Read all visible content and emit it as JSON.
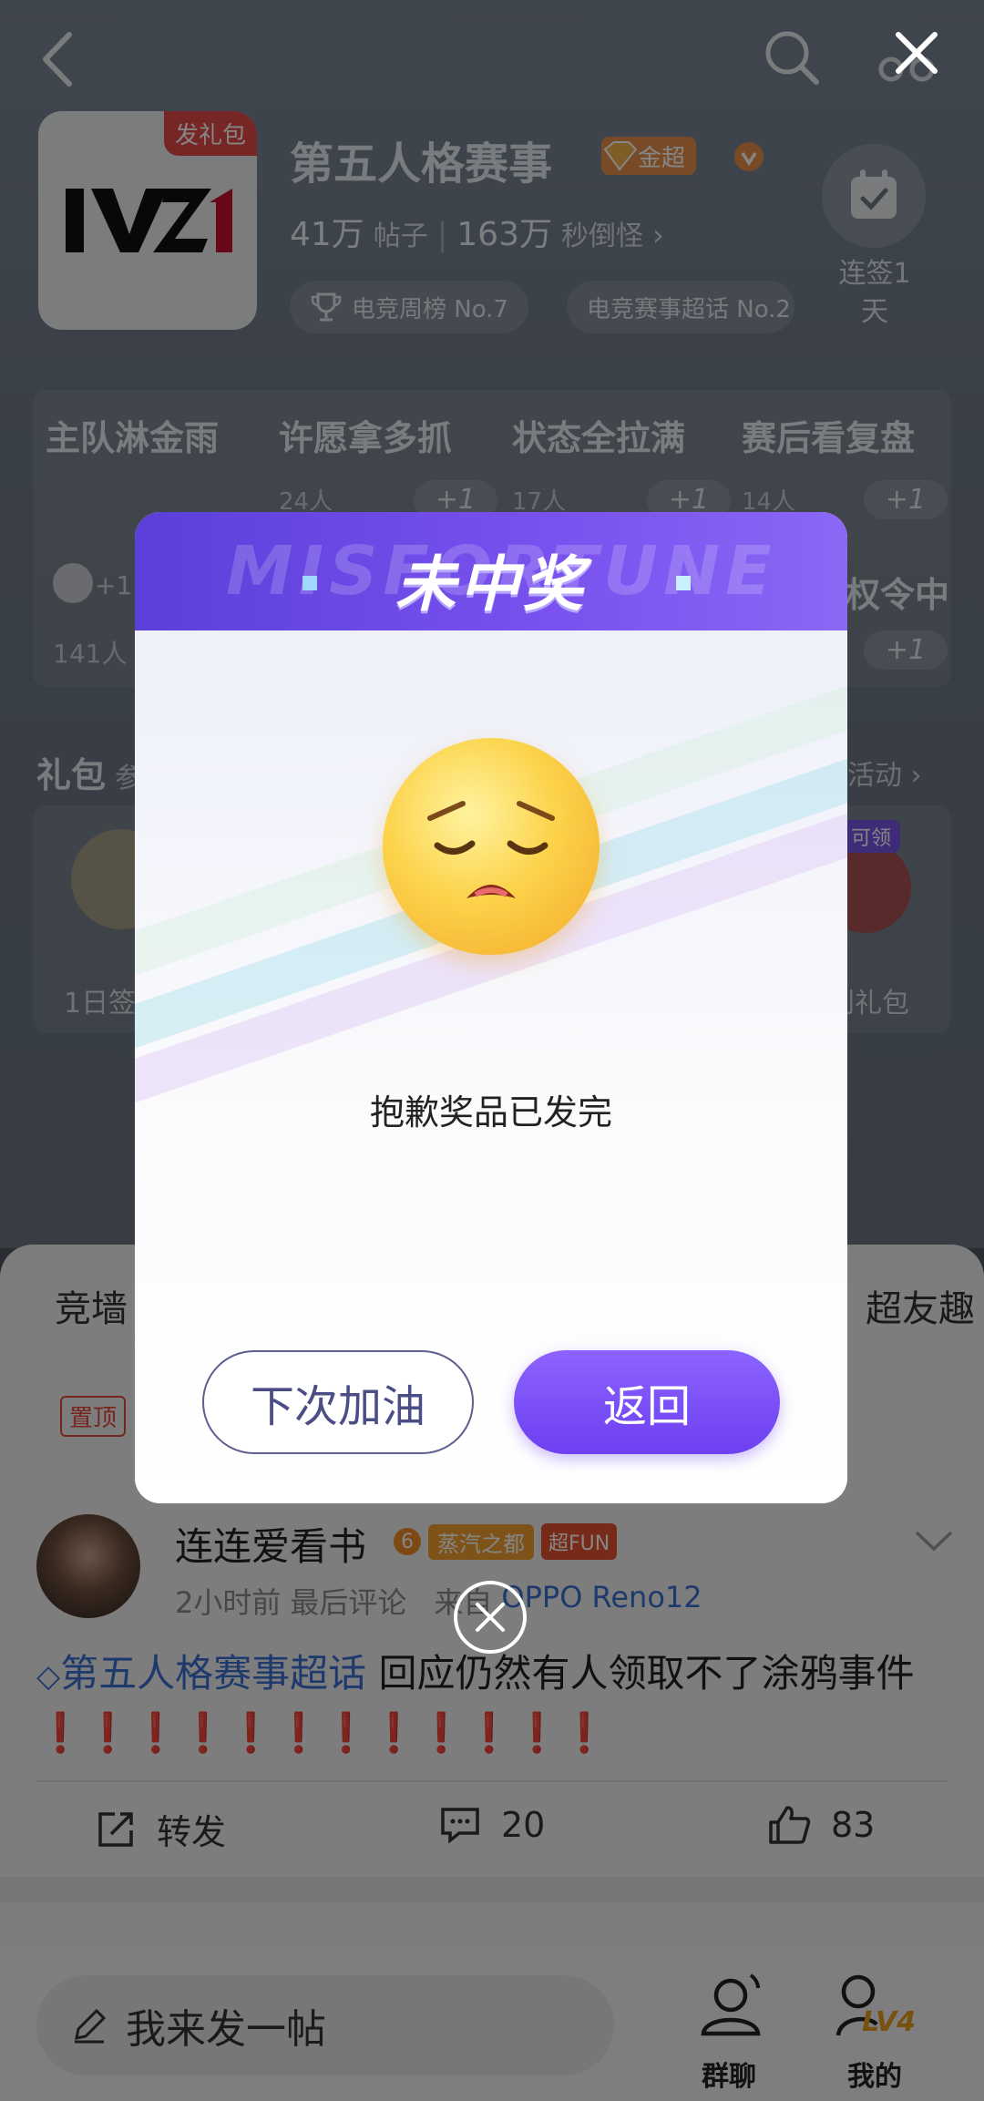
{
  "topbar": {
    "back_icon": "back-arrow-icon",
    "search_icon": "search-icon",
    "close_icon": "close-icon"
  },
  "community": {
    "gift_badge": "发礼包",
    "name": "第五人格赛事",
    "level_tag": "金超",
    "posts_count": "41万",
    "posts_label": "帖子",
    "members_count": "163万",
    "members_label": "秒倒怪",
    "chevron": "›",
    "rank_chips": [
      "电竞周榜 No.7",
      "电竞赛事超话 No.2"
    ],
    "checkin_label_1": "连签1",
    "checkin_label_2": "天"
  },
  "wishes": [
    {
      "title": "主队淋金雨",
      "count": "",
      "plus": "+1"
    },
    {
      "title": "许愿拿多抓",
      "count": "24人",
      "plus": "+1"
    },
    {
      "title": "状态全拉满",
      "count": "17人",
      "plus": "+1"
    },
    {
      "title": "赛后看复盘",
      "count": "14人",
      "plus": "+1"
    }
  ],
  "wish_row2": {
    "left_count": "141人",
    "left_plus": "+1",
    "right_title": "权令中",
    "right_plus": "+1"
  },
  "gifts": {
    "title": "礼包",
    "title_rest": "参",
    "more": "活动 ›",
    "item_left": "1日签",
    "item_right": "到礼包",
    "right_badge": "可领"
  },
  "tabs": {
    "left": "竞墙",
    "right": "超友趣"
  },
  "pinned": "置顶",
  "post": {
    "author": "连连爱看书",
    "badge_level": "6",
    "badge_text": "蒸汽之都",
    "fun_badge": "超FUN",
    "time": "2小时前",
    "last_comment": "最后评论",
    "device_prefix": "来自",
    "device": "OPPO Reno12",
    "topic": "第五人格赛事超话",
    "text": " 回应仍然有人领取不了涂鸦事件",
    "exclaims": "❗❗❗❗❗❗❗❗❗❗❗❗",
    "repost_label": "转发",
    "comments": "20",
    "likes": "83"
  },
  "bottom_bar": {
    "compose_placeholder": "我来发一帖",
    "nav_chat": "群聊",
    "nav_me": "我的",
    "me_level": "LV4"
  },
  "dialog": {
    "banner_text": "MISFORTUNE",
    "title": "未中奖",
    "emoji": "😔",
    "message": "抱歉奖品已发完",
    "button_next": "下次加油",
    "button_back": "返回"
  },
  "colors": {
    "accent_purple": "#6d3ff0",
    "overlay": "rgba(0,0,0,0.48)",
    "link_blue": "#3b6fd1",
    "orange_badge": "#f08a24"
  }
}
